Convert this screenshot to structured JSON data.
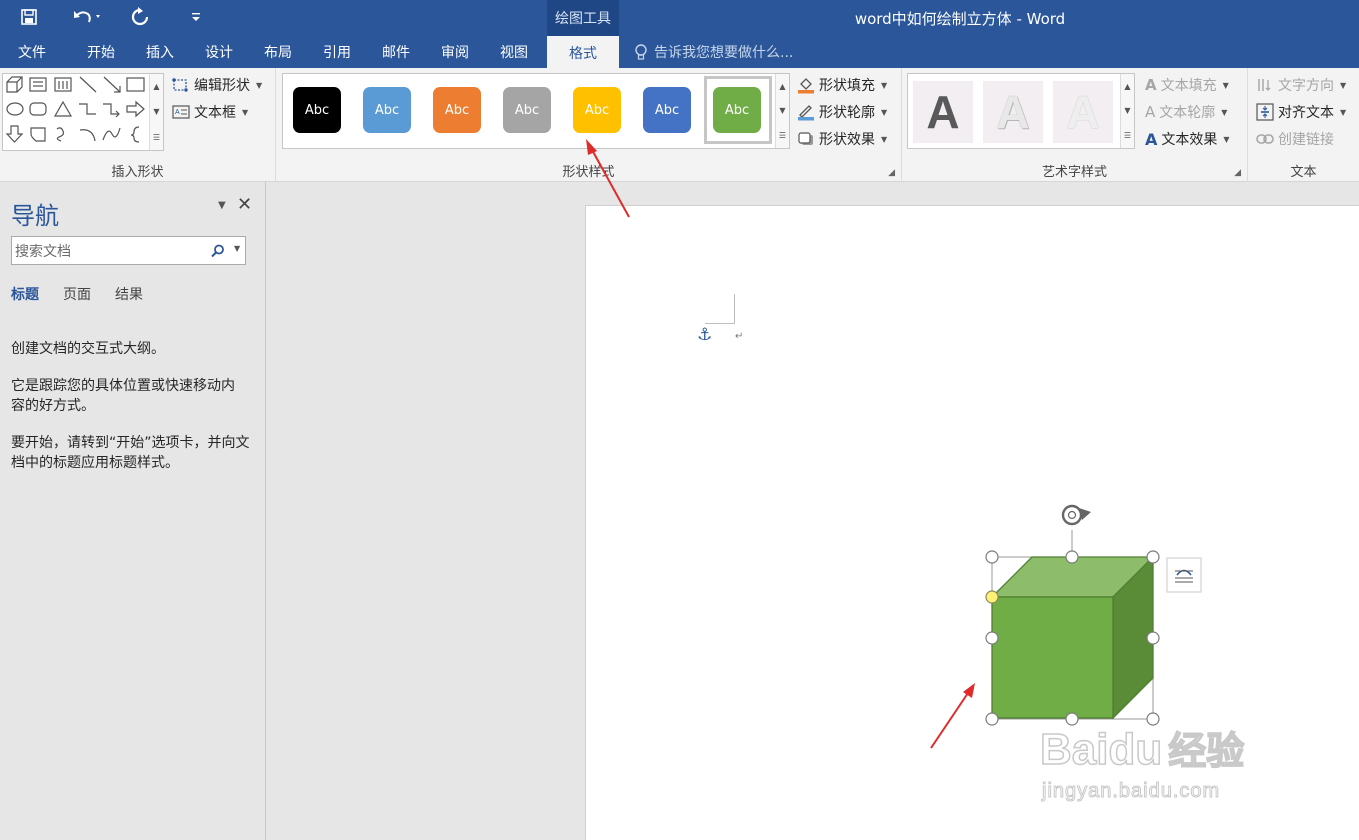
{
  "window": {
    "title": "word中如何绘制立方体 - Word",
    "context_tab_group": "绘图工具"
  },
  "quick_access": {
    "save_icon": "save-icon",
    "undo_icon": "undo-icon",
    "redo_icon": "redo-icon",
    "customize_icon": "customize-icon"
  },
  "tabs": [
    {
      "label": "文件"
    },
    {
      "label": "开始"
    },
    {
      "label": "插入"
    },
    {
      "label": "设计"
    },
    {
      "label": "布局"
    },
    {
      "label": "引用"
    },
    {
      "label": "邮件"
    },
    {
      "label": "审阅"
    },
    {
      "label": "视图"
    },
    {
      "label": "格式",
      "active": true
    }
  ],
  "tell_me": {
    "placeholder": "告诉我您想要做什么..."
  },
  "ribbon": {
    "insert_shapes": {
      "label": "插入形状",
      "edit_shape": "编辑形状",
      "text_box": "文本框"
    },
    "shape_styles": {
      "label": "形状样式",
      "swatch_text": "Abc",
      "swatches": [
        {
          "color": "#000000"
        },
        {
          "color": "#5b9bd5"
        },
        {
          "color": "#ed7d31"
        },
        {
          "color": "#a5a5a5"
        },
        {
          "color": "#ffc000"
        },
        {
          "color": "#4472c4"
        },
        {
          "color": "#70ad47",
          "selected": true
        }
      ],
      "shape_fill": "形状填充",
      "shape_outline": "形状轮廓",
      "shape_effects": "形状效果"
    },
    "wordart_styles": {
      "label": "艺术字样式",
      "letter": "A",
      "text_fill": "文本填充",
      "text_outline": "文本轮廓",
      "text_effects": "文本效果"
    },
    "text": {
      "label": "文本",
      "text_direction": "文字方向",
      "align_text": "对齐文本",
      "create_link": "创建链接"
    }
  },
  "navigation": {
    "title": "导航",
    "search_placeholder": "搜索文档",
    "tabs": [
      {
        "label": "标题",
        "active": true
      },
      {
        "label": "页面"
      },
      {
        "label": "结果"
      }
    ],
    "body": [
      "创建文档的交互式大纲。",
      "它是跟踪您的具体位置或快速移动内容的好方式。",
      "要开始，请转到“开始”选项卡，并向文档中的标题应用标题样式。"
    ]
  },
  "document": {
    "shape": {
      "kind": "cube",
      "front_color": "#70ad47",
      "top_color": "#8dbd6b",
      "side_color": "#5a8c38",
      "outline_color": "#4f7f31"
    },
    "paragraph_mark": "↵"
  },
  "watermark": {
    "brand": "Baidu",
    "brand_cn": "经验",
    "url": "jingyan.baidu.com"
  },
  "colors": {
    "brand_blue": "#2b579a",
    "annotation_red": "#e02b2b"
  }
}
